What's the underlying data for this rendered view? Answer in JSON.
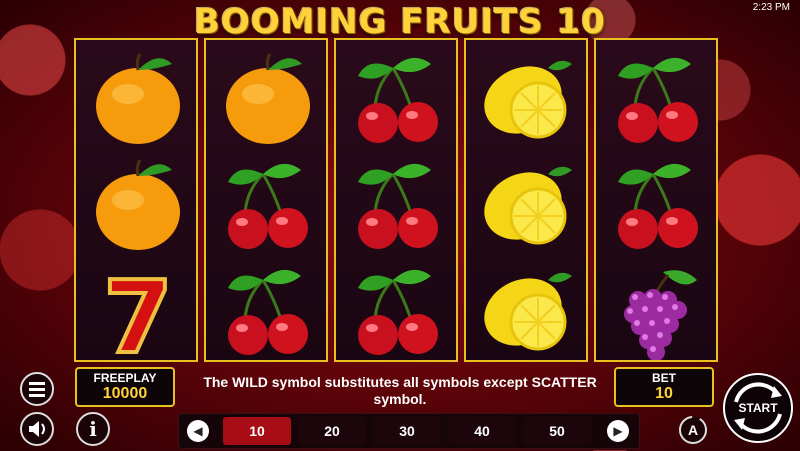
{
  "status": {
    "time": "2:23 PM"
  },
  "game": {
    "title": "BOOMING FRUITS 10"
  },
  "reels": [
    [
      "orange",
      "orange",
      "seven"
    ],
    [
      "orange",
      "cherry",
      "cherry"
    ],
    [
      "cherry",
      "cherry",
      "cherry"
    ],
    [
      "lemon",
      "lemon",
      "lemon"
    ],
    [
      "cherry",
      "cherry",
      "grapes"
    ]
  ],
  "freeplay": {
    "label": "FREEPLAY",
    "value": "10000"
  },
  "message": "The WILD symbol substitutes all symbols except SCATTER symbol.",
  "bet": {
    "label": "BET",
    "value": "10"
  },
  "bet_options": [
    "10",
    "20",
    "30",
    "40",
    "50"
  ],
  "selected_bet": "10",
  "buttons": {
    "start": "START",
    "info": "i",
    "auto": "A"
  },
  "colors": {
    "frame": "#e8c020",
    "accent": "#ffd23a",
    "selected": "#a80c14"
  }
}
